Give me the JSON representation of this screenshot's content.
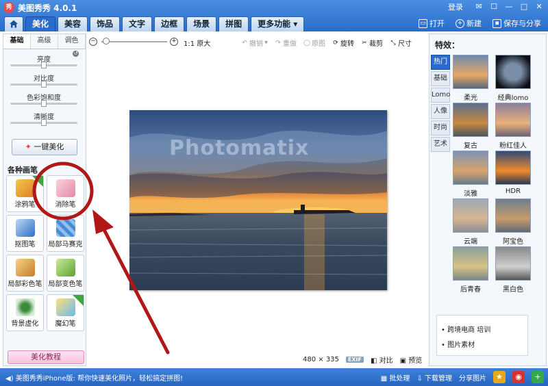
{
  "app": {
    "title": "美图秀秀 4.0.1",
    "logo_text": "秀",
    "login_label": "登录"
  },
  "window_buttons": [
    "✉",
    "☐",
    "—",
    "□",
    "✕"
  ],
  "tabs": [
    {
      "label": "美化"
    },
    {
      "label": "美容"
    },
    {
      "label": "饰品"
    },
    {
      "label": "文字"
    },
    {
      "label": "边框"
    },
    {
      "label": "场景"
    },
    {
      "label": "拼图"
    },
    {
      "label": "更多功能 ▾"
    }
  ],
  "top_actions": {
    "open": "打开",
    "new": "新建",
    "save": "保存与分享"
  },
  "left_panel": {
    "subtabs": [
      "基础",
      "高级",
      "调色"
    ],
    "sliders": [
      "亮度",
      "对比度",
      "色彩饱和度",
      "清晰度"
    ],
    "one_key_label": "一键美化",
    "brush_section_title": "各种画笔",
    "brushes": [
      {
        "label": "涂鸦笔",
        "new": true
      },
      {
        "label": "消除笔",
        "new": false
      },
      {
        "label": "抠图笔",
        "new": false
      },
      {
        "label": "局部马赛克",
        "new": false
      },
      {
        "label": "局部彩色笔",
        "new": false
      },
      {
        "label": "局部变色笔",
        "new": false
      },
      {
        "label": "背景虚化",
        "new": false
      },
      {
        "label": "魔幻笔",
        "new": true
      }
    ],
    "tutorial_label": "美化教程"
  },
  "toolbar": {
    "original_size": "1:1 原大",
    "undo": "撤销",
    "redo": "重做",
    "original": "原图",
    "rotate": "旋转",
    "crop": "裁剪",
    "size": "尺寸"
  },
  "canvas": {
    "photo_watermark": "Photomatix",
    "dimensions": "480 × 335",
    "exif": "EXIF",
    "compare": "对比",
    "preview": "预览"
  },
  "effects_panel": {
    "title": "特效：",
    "categories": [
      "热门",
      "基础",
      "Lomo",
      "人像",
      "时尚",
      "艺术"
    ],
    "effects": [
      "柔光",
      "经典lomo",
      "复古",
      "粉红佳人",
      "淡雅",
      "HDR",
      "云端",
      "阿宝色",
      "后青春",
      "黑白色"
    ],
    "ad_items": [
      "跨境电商 培训",
      "图片素材"
    ]
  },
  "statusbar": {
    "message": "美图秀秀iPhone版: 帮你快速美化照片，轻松搞定拼图!",
    "batch": "批处理",
    "download": "下载管理",
    "share": "分享图片"
  },
  "colors": {
    "title_bar": "#2a6ccd",
    "accent": "#2a6ccd",
    "annotation": "#b01818"
  }
}
